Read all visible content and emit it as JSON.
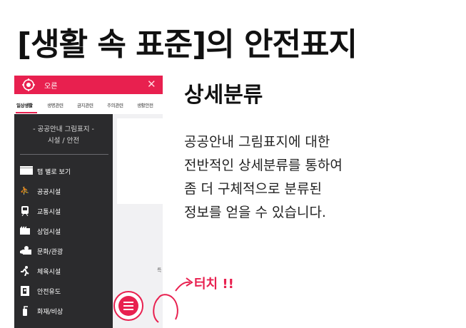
{
  "headline": "[생활 속 표준]의 안전표지",
  "phone": {
    "search_text": "오른",
    "close_symbol": "✕",
    "tabs": [
      {
        "label": "일상생활",
        "active": true
      },
      {
        "label": "생명관련",
        "active": false
      },
      {
        "label": "금지관련",
        "active": false
      },
      {
        "label": "주의관련",
        "active": false
      },
      {
        "label": "생활안전",
        "active": false
      }
    ],
    "sidebar": {
      "heading_line1": "- 공공안내 그림표지 -",
      "heading_line2": "시설 / 안전",
      "items": [
        {
          "label": "탭 별로 보기",
          "icon": "clapper-icon"
        },
        {
          "label": "공공시설",
          "icon": "public-facility-icon"
        },
        {
          "label": "교통시설",
          "icon": "train-icon"
        },
        {
          "label": "상업시설",
          "icon": "shop-icon"
        },
        {
          "label": "문화/관광",
          "icon": "camera-icon"
        },
        {
          "label": "체육시설",
          "icon": "running-icon"
        },
        {
          "label": "안전유도",
          "icon": "exit-icon"
        },
        {
          "label": "화재/비상",
          "icon": "fire-extinguisher-icon"
        }
      ]
    },
    "content_text": "특"
  },
  "touch_label": "터치 !!",
  "section_title": "상세분류",
  "description": [
    "공공안내 그림표지에 대한",
    "전반적인 상세분류를 통하여",
    "좀 더 구체적으로 분류된",
    "정보를 얻을 수 있습니다."
  ],
  "colors": {
    "accent": "#e8204f",
    "sidebar_bg": "#2b2b2d"
  }
}
